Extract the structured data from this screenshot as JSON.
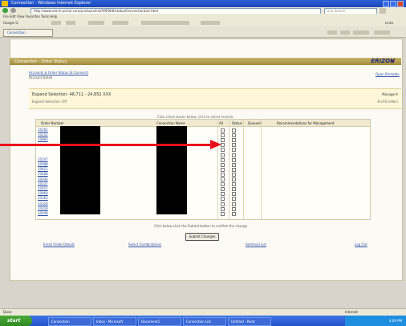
{
  "window": {
    "title": "Connection - Windows Internet Explorer"
  },
  "browser": {
    "address": "http://www.vtech-portal.com/products/list/A9R0E8/status/ConnectionList.html",
    "menu": "File  Edit  View  Favorites  Tools  Help",
    "google_label": "Google G-",
    "tab_label": "Connection",
    "search_text": "Live Search",
    "links_label": "Links"
  },
  "page": {
    "banner_title": "Connection - Order Status",
    "logo_left": "V",
    "logo_right": "ERIZON",
    "heading": "Accounts & Order Status (E.Connect)",
    "subheading": "Account Detail",
    "top_right_link": "Open Printable",
    "info": {
      "title": "Expand Selection: 48,711 - 24,852 XXX",
      "subtitle": "Expand Selection: Off",
      "right_top": "Manage It",
      "right_bottom": "8 of 8 orders"
    },
    "table": {
      "columns": [
        "Order Number",
        "Connection Name",
        "All",
        "Status",
        "Queued",
        "Recommendations for Management"
      ],
      "group_header": "Click check boxes below, click to select records",
      "rows": [
        {
          "id": "10261"
        },
        {
          "id": "10252"
        },
        {
          "id": "10883"
        },
        {
          "id": ""
        },
        {
          "id": ""
        },
        {
          "id": ""
        },
        {
          "id": "10247"
        },
        {
          "id": "10688"
        },
        {
          "id": "10621"
        },
        {
          "id": "10468"
        },
        {
          "id": "10331"
        },
        {
          "id": "10237"
        },
        {
          "id": "10421"
        },
        {
          "id": "10869"
        },
        {
          "id": "10362"
        },
        {
          "id": "10318"
        },
        {
          "id": "10318"
        },
        {
          "id": "10448"
        }
      ]
    },
    "footer_note": "Click below click the Submit button to confirm the change",
    "submit_label": "Submit Changes",
    "bottom_links": [
      "Email Order Details",
      "Select Combinations",
      "Sentmail List",
      "Log Out"
    ]
  },
  "statusbar": {
    "left": "Done",
    "right": "Internet"
  },
  "taskbar": {
    "start": "start",
    "tasks": [
      "Connection",
      "Inbox - Microsoft",
      "Document1",
      "Connection List",
      "Untitled - Paint"
    ],
    "clock": "4:09 PM"
  },
  "colors": {
    "arrow": "#e8101a",
    "banner": "#b8a352",
    "link": "#2d50a8",
    "taskbar": "#2452c8"
  }
}
